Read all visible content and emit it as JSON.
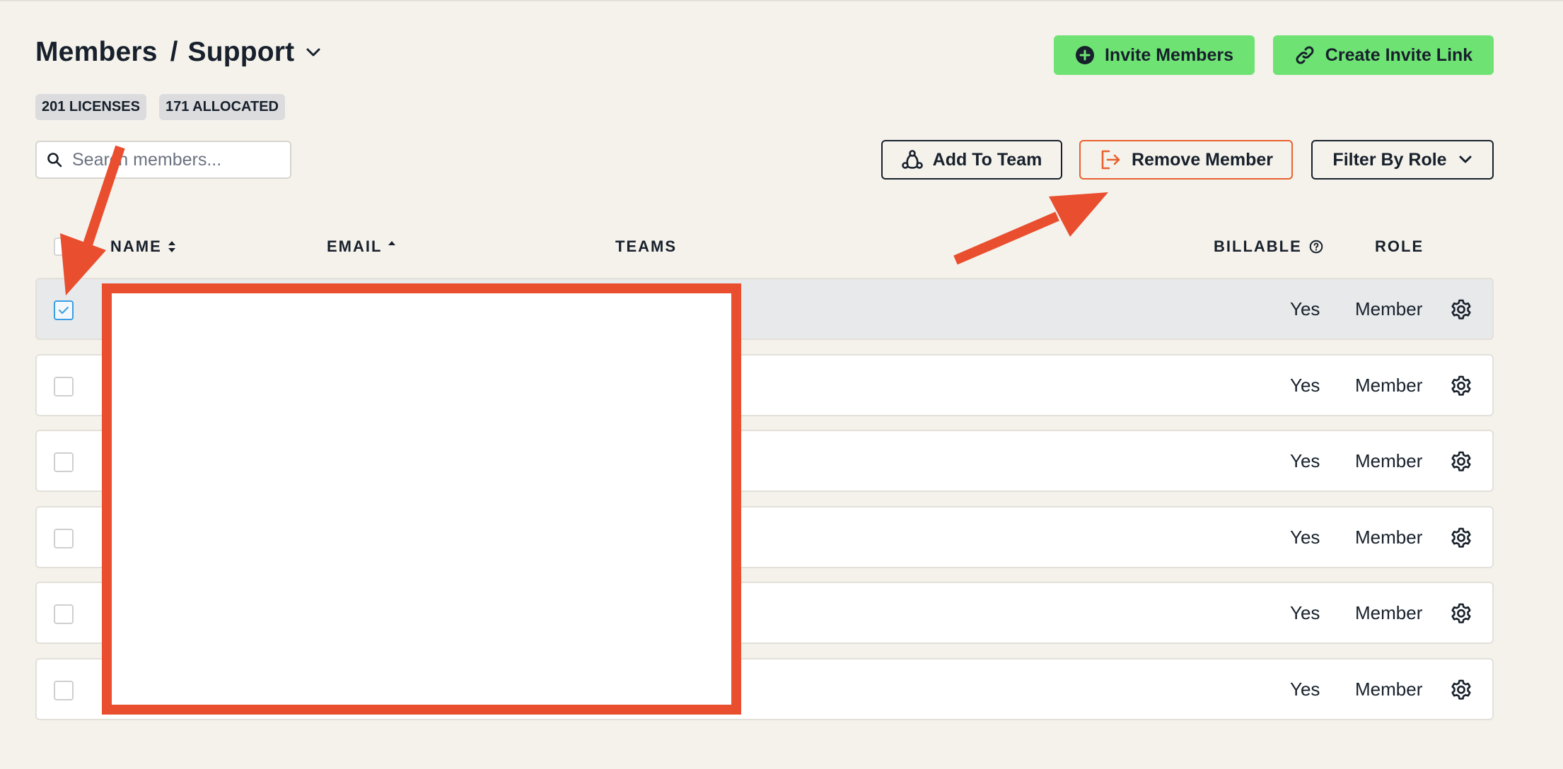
{
  "header": {
    "title": "Members",
    "separator": "/",
    "team": "Support",
    "invite_label": "Invite Members",
    "invite_link_label": "Create Invite Link"
  },
  "badges": {
    "licenses": "201 LICENSES",
    "allocated": "171 ALLOCATED"
  },
  "search": {
    "placeholder": "Search members..."
  },
  "toolbar": {
    "add_to_team": "Add To Team",
    "remove_member": "Remove Member",
    "filter_by_role": "Filter By Role"
  },
  "table": {
    "columns": {
      "name": "NAME",
      "email": "EMAIL",
      "teams": "TEAMS",
      "billable": "BILLABLE",
      "role": "ROLE"
    },
    "rows": [
      {
        "selected": true,
        "billable": "Yes",
        "role": "Member"
      },
      {
        "selected": false,
        "billable": "Yes",
        "role": "Member"
      },
      {
        "selected": false,
        "billable": "Yes",
        "role": "Member"
      },
      {
        "selected": false,
        "billable": "Yes",
        "role": "Member"
      },
      {
        "selected": false,
        "billable": "Yes",
        "role": "Member"
      },
      {
        "selected": false,
        "billable": "Yes",
        "role": "Member"
      }
    ]
  },
  "colors": {
    "background": "#f5f2ec",
    "primary_green": "#6ee374",
    "danger_orange": "#e8612f",
    "annotation_red": "#e94e2e",
    "text_dark": "#17202b",
    "selected_row": "#e8e9eb",
    "checkbox_blue": "#3b9ee0"
  },
  "icons": {
    "invite": "plus-circle-icon",
    "invite_link": "link-icon",
    "search": "search-icon",
    "add_to_team": "team-network-icon",
    "remove_member": "exit-icon",
    "filter": "chevron-down-icon",
    "row_settings": "gear-icon",
    "billable_help": "help-circle-icon"
  }
}
